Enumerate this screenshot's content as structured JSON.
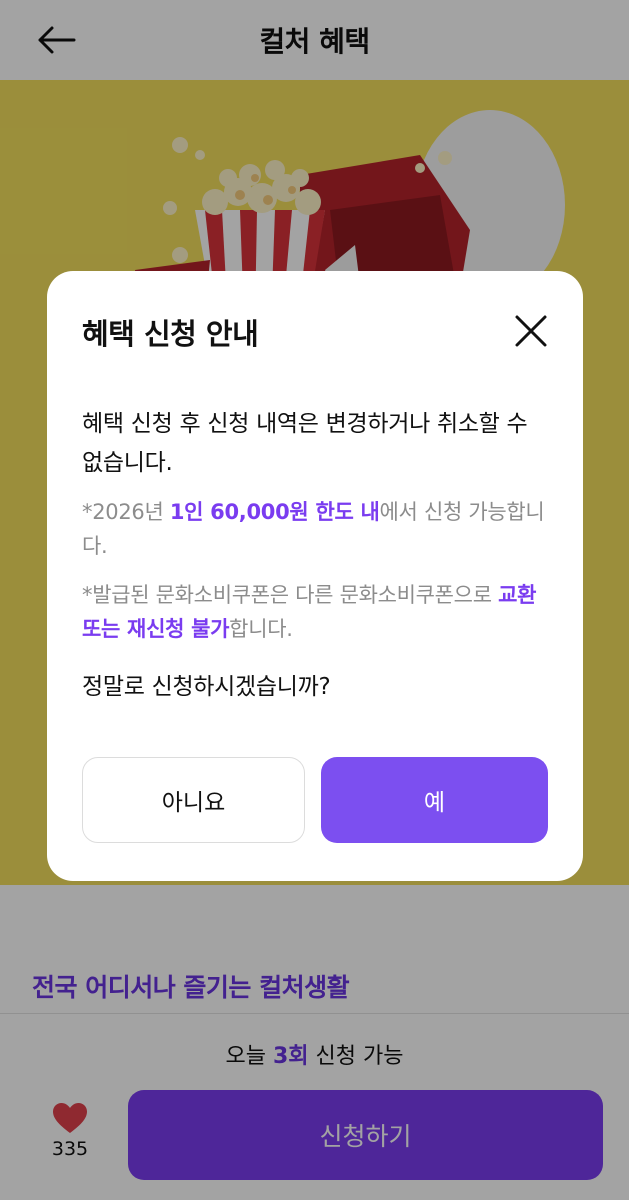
{
  "header": {
    "title": "컬처 혜택",
    "back_icon": "arrow-left-icon"
  },
  "colors": {
    "accent": "#7c4ff0",
    "accent_dark": "#6a34e0",
    "hero_background": "#f2df5d",
    "overlay": "rgba(0,0,0,0.36)",
    "like_heart": "#e0414b"
  },
  "page": {
    "promo_text": "전국 어디서나 즐기는 컬처생활",
    "quota": {
      "prefix": "오늘 ",
      "count": "3회",
      "suffix": " 신청 가능"
    },
    "like_icon": "heart-icon",
    "like_count": "335",
    "apply_label": "신청하기"
  },
  "modal": {
    "title": "혜택 신청 안내",
    "close_icon": "close-icon",
    "main_text": "혜택 신청 후 신청 내역은 변경하거나 취소할 수 없습니다.",
    "note1": {
      "pre": "*2026년 ",
      "highlight": "1인 60,000원 한도 내",
      "post": "에서 신청 가능합니다."
    },
    "note2": {
      "pre": "*발급된 문화소비쿠폰은 다른 문화소비쿠폰으로 ",
      "highlight": "교환 또는 재신청 불가",
      "post": "합니다."
    },
    "confirm_text": "정말로 신청하시겠습니까?",
    "no_label": "아니요",
    "yes_label": "예"
  }
}
